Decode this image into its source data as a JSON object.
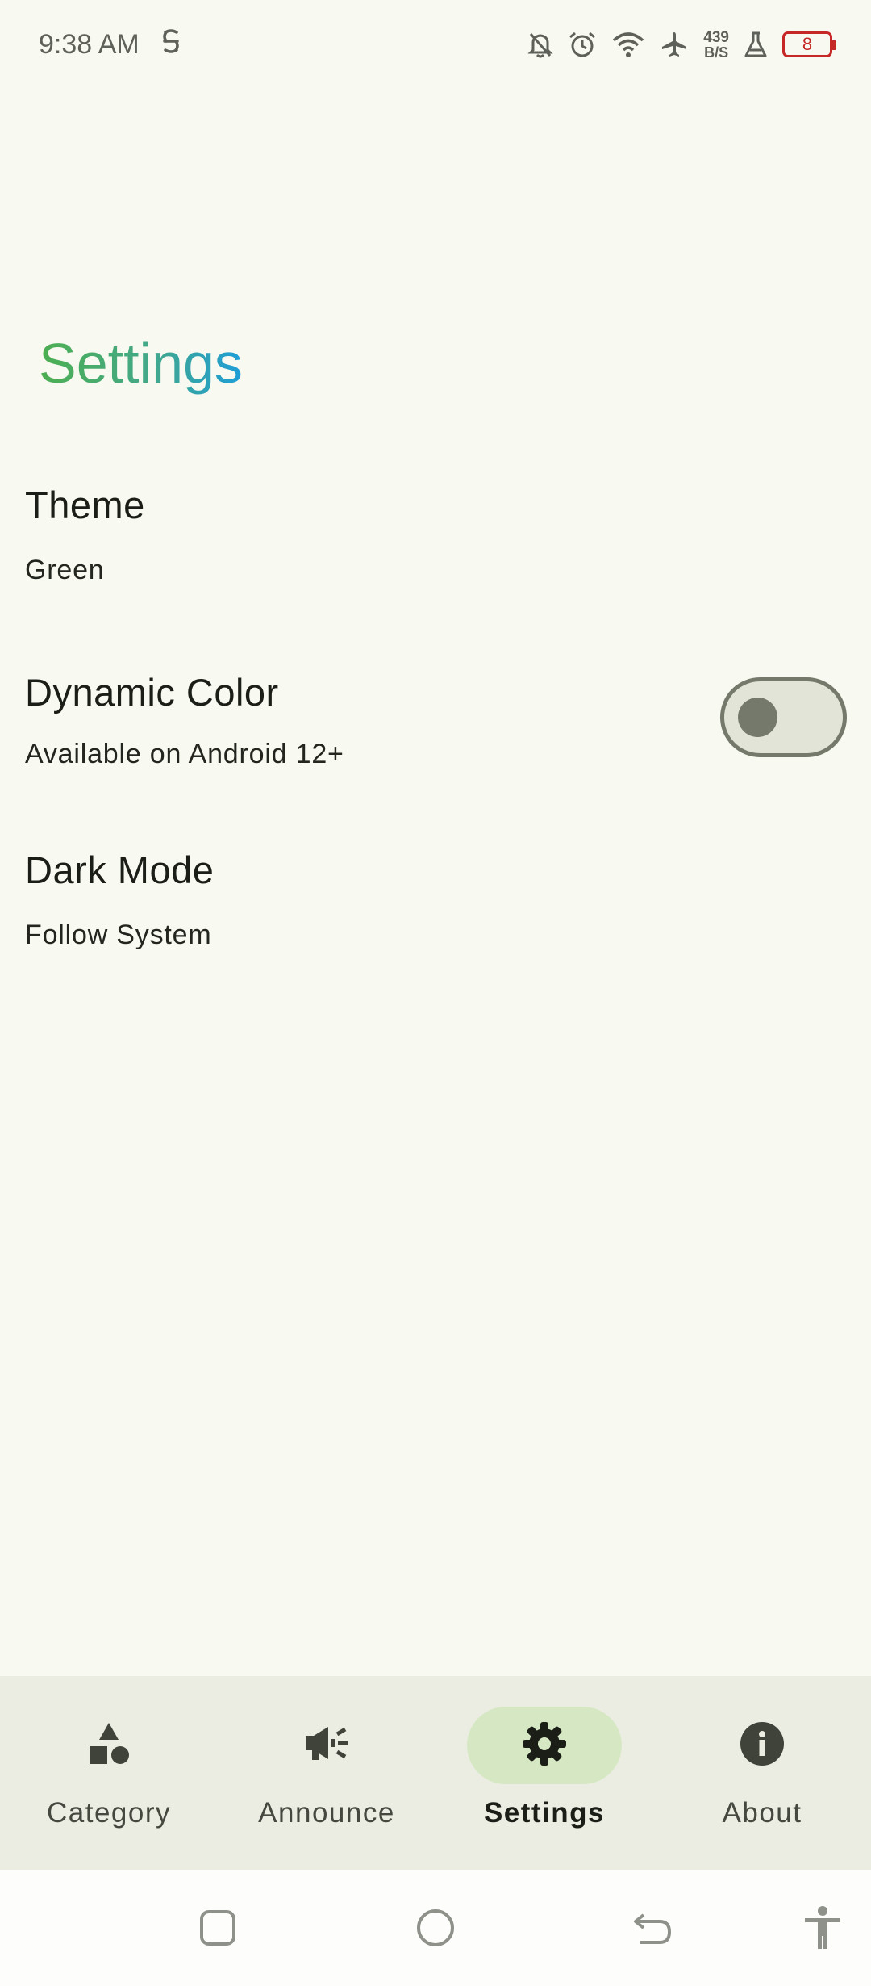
{
  "status_bar": {
    "time": "9:38 AM",
    "net_speed_value": "439",
    "net_speed_unit": "B/S",
    "battery_level": "8",
    "battery_color": "#C62828",
    "icons": [
      "data-saver-icon",
      "notifications-off-icon",
      "alarm-icon",
      "wifi-icon",
      "airplane-mode-icon",
      "lab-flask-icon",
      "battery-icon"
    ]
  },
  "page": {
    "title": "Settings",
    "title_gradient": [
      "#4CAF50",
      "#1E9ED8"
    ]
  },
  "settings": {
    "theme": {
      "title": "Theme",
      "value": "Green"
    },
    "dynamic_color": {
      "title": "Dynamic Color",
      "subtitle": "Available on Android 12+",
      "enabled": false
    },
    "dark_mode": {
      "title": "Dark Mode",
      "value": "Follow System"
    }
  },
  "bottom_nav": {
    "items": [
      {
        "label": "Category",
        "icon": "category-icon",
        "active": false
      },
      {
        "label": "Announce",
        "icon": "campaign-icon",
        "active": false
      },
      {
        "label": "Settings",
        "icon": "gear-icon",
        "active": true
      },
      {
        "label": "About",
        "icon": "info-icon",
        "active": false
      }
    ],
    "active_indicator_color": "#D6E8C3"
  },
  "system_nav": {
    "buttons": [
      "recents-icon",
      "home-icon",
      "back-icon",
      "accessibility-icon"
    ]
  }
}
